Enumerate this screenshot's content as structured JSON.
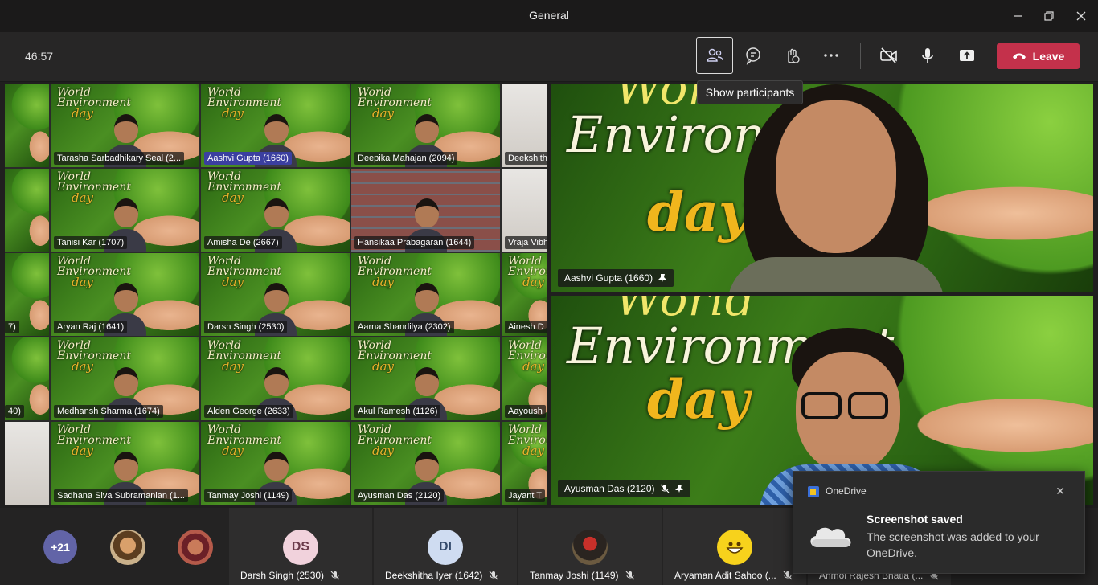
{
  "window": {
    "title": "General"
  },
  "toolbar": {
    "timer": "46:57",
    "tooltip": "Show participants",
    "leave_label": "Leave"
  },
  "gallery": {
    "tiles": [
      {
        "name": "Tarasha Sarbadhikary Seal (2..."
      },
      {
        "name": "Aashvi Gupta (1660)"
      },
      {
        "name": "Deepika Mahajan (2094)"
      },
      {
        "name": "Deekshith"
      },
      {
        "name": "Tanisi Kar (1707)"
      },
      {
        "name": "Amisha De (2667)"
      },
      {
        "name": "Hansikaa Prabagaran (1644)"
      },
      {
        "name": "Vraja Vibh"
      },
      {
        "name": "Aryan Raj (1641)"
      },
      {
        "name": "Darsh Singh (2530)"
      },
      {
        "name": "Aarna Shandilya (2302)"
      },
      {
        "name": "Ainesh D"
      },
      {
        "name": "Medhansh Sharma (1674)"
      },
      {
        "name": "Alden George (2633)"
      },
      {
        "name": "Akul Ramesh (1126)"
      },
      {
        "name": "Aayoush"
      },
      {
        "name": "Sadhana Siva Subramanian (1..."
      },
      {
        "name": "Tanmay Joshi (1149)"
      },
      {
        "name": "Ayusman Das (2120)"
      },
      {
        "name": "Jayant T"
      }
    ],
    "bg_word": "World",
    "bg_word2": "Environment",
    "bg_word3": "day",
    "edge_labels": [
      "7)",
      "40)"
    ]
  },
  "featured": [
    {
      "name": "Aashvi Gupta (1660)",
      "words": [
        "Environm",
        "day",
        "Worl"
      ]
    },
    {
      "name": "Ayusman Das (2120)",
      "words": [
        "Environment",
        "day",
        "World"
      ]
    }
  ],
  "strip": {
    "overflow_count": "+21",
    "participants": [
      {
        "initials": "DS",
        "name": "Darsh Singh (2530)",
        "color": "#f1d2dc",
        "text": "#6b3b4b"
      },
      {
        "initials": "DI",
        "name": "Deekshitha Iyer (1642)",
        "color": "#cfdcf1",
        "text": "#344a6b"
      },
      {
        "initials": "",
        "name": "Tanmay Joshi (1149)",
        "color": "#3b2f2a",
        "text": "#fff"
      },
      {
        "initials": "",
        "name": "Aryaman Adit Sahoo (...",
        "color": "#1e1e1e",
        "text": "#fff"
      },
      {
        "initials": "",
        "name": "Anmol Rajesh Bhatia (...",
        "color": "#1e1e1e",
        "text": "#fff"
      }
    ]
  },
  "toast": {
    "app": "OneDrive",
    "title": "Screenshot saved",
    "body": "The screenshot was added to your OneDrive."
  },
  "colors": {
    "leave": "#c4314b",
    "accent": "#6264a7"
  }
}
